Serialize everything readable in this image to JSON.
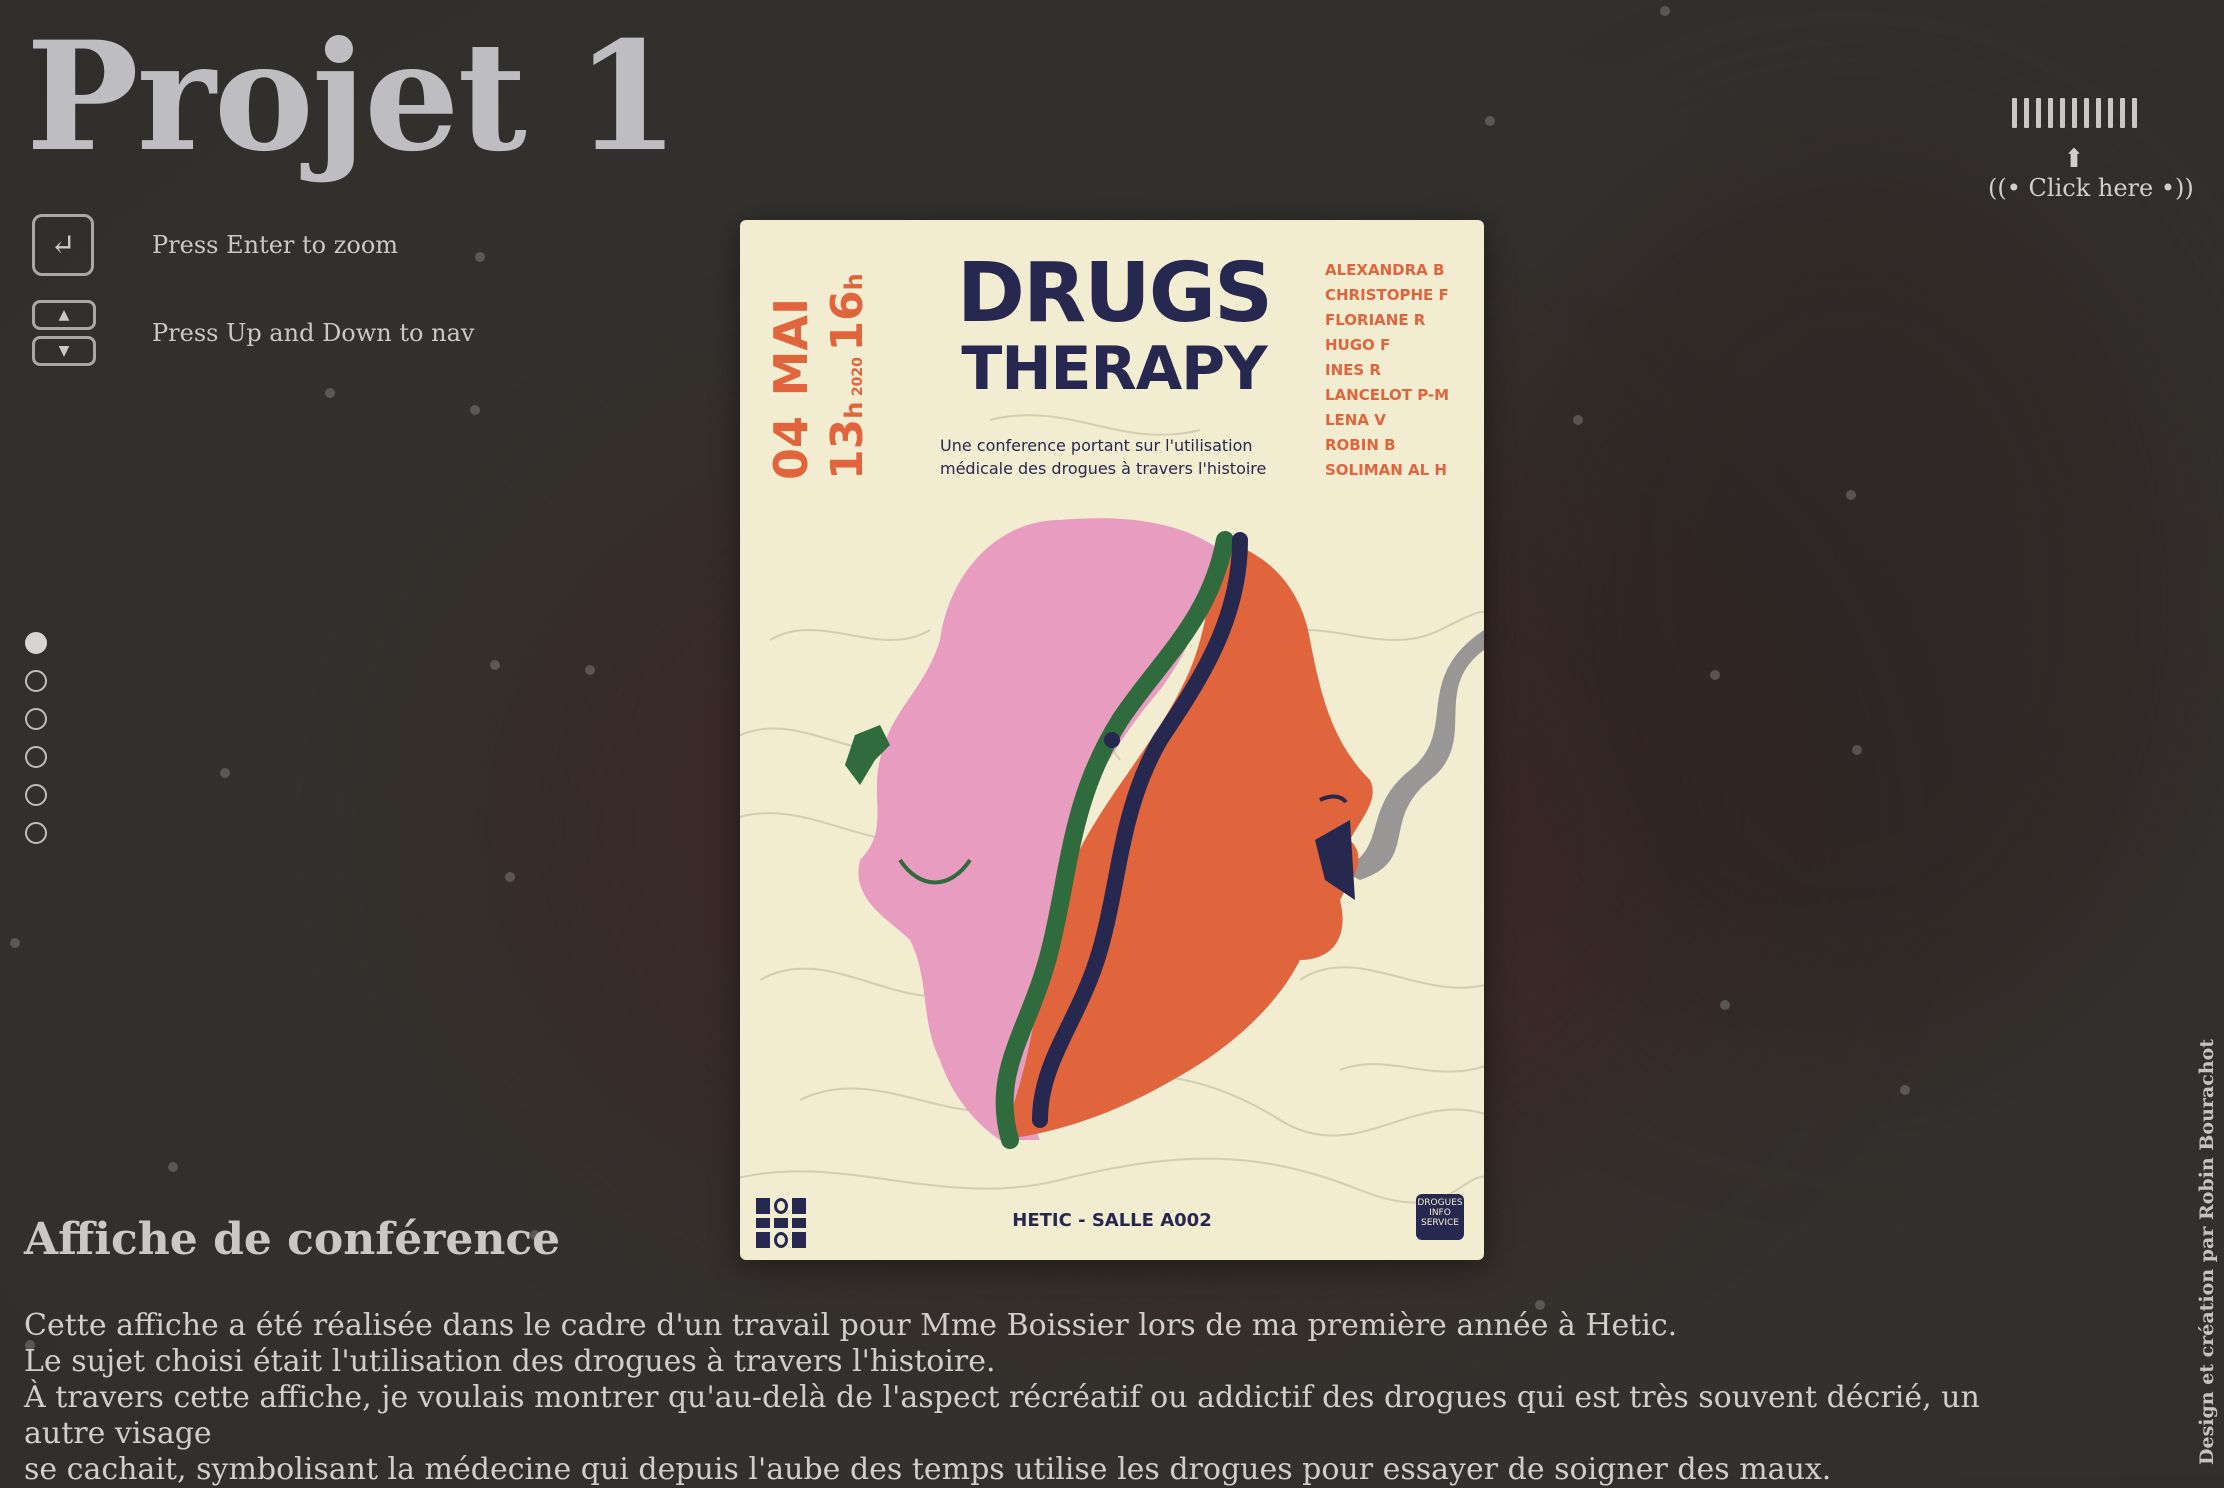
{
  "page": {
    "title": "Projet 1",
    "subtitle": "Affiche de conférence",
    "description": [
      "Cette affiche a été réalisée dans le cadre d'un travail pour Mme Boissier lors de ma première année à Hetic.",
      "Le sujet choisi était l'utilisation des drogues à travers l'histoire.",
      "À travers cette affiche, je voulais montrer qu'au-delà de l'aspect récréatif ou addictif des drogues qui est très souvent décrié, un autre visage",
      "se cachait, symbolisant la médecine qui depuis l'aube des temps utilise les drogues pour essayer de soigner des maux."
    ],
    "credit": "Design et création par Robin Bourachot"
  },
  "hints": {
    "zoom": {
      "label": "Press Enter to zoom",
      "icon": "enter-key-icon"
    },
    "nav": {
      "label": "Press Up and Down to nav",
      "icon": "up-down-keys-icon"
    }
  },
  "sound": {
    "label": "Click here",
    "icon_left": "sound-left-icon",
    "icon_right": "sound-right-icon",
    "bars": 11
  },
  "pagination": {
    "count": 6,
    "active": 0
  },
  "poster": {
    "title_line1": "DRUGS",
    "title_line2": "THERAPY",
    "tagline_line1": "Une conference portant sur l'utilisation",
    "tagline_line2": "médicale des drogues à travers l'histoire",
    "date_day": "04",
    "date_month": "MAI",
    "time_start": "13",
    "time_end": "16",
    "time_unit": "h",
    "year": "2020",
    "names": [
      "ALEXANDRA B",
      "CHRISTOPHE F",
      "FLORIANE R",
      "HUGO F",
      "INES R",
      "LANCELOT P-M",
      "LENA V",
      "ROBIN B",
      "SOLIMAN AL H"
    ],
    "venue": "HETIC - SALLE A002",
    "badge": [
      "DROGUES",
      "INFO",
      "SERVICE"
    ],
    "colors": {
      "navy": "#27284f",
      "orange": "#e0643c",
      "pink": "#e79cc0",
      "green": "#2f6b3c",
      "cream": "#f2ecd1",
      "smoke": "#8e8e8e"
    }
  }
}
